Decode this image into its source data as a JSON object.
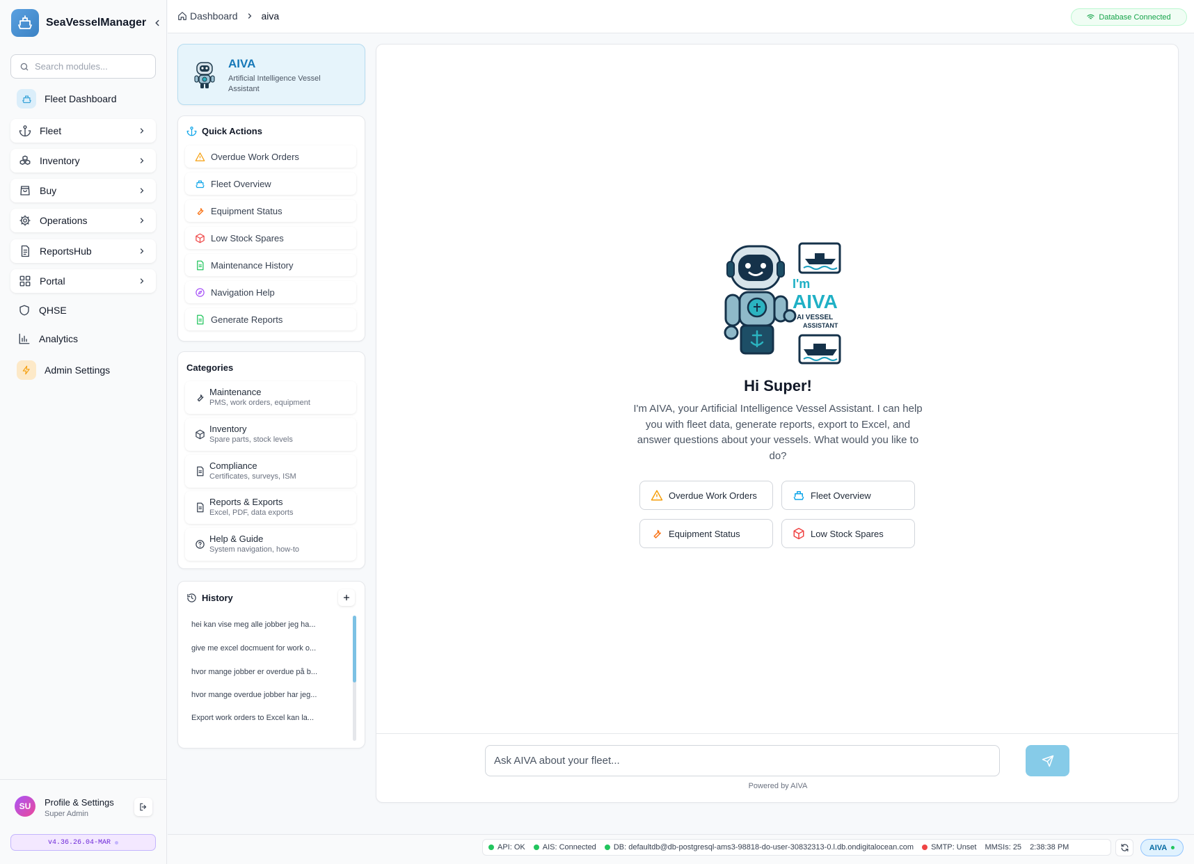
{
  "app": {
    "name": "SeaVesselManager"
  },
  "sidebar": {
    "search_placeholder": "Search modules...",
    "fleet_dashboard": "Fleet Dashboard",
    "items": [
      {
        "label": "Fleet",
        "icon": "anchor-icon"
      },
      {
        "label": "Inventory",
        "icon": "boxes-icon"
      },
      {
        "label": "Buy",
        "icon": "shopping-bag-icon"
      },
      {
        "label": "Operations",
        "icon": "gear-icon"
      },
      {
        "label": "ReportsHub",
        "icon": "document-icon"
      },
      {
        "label": "Portal",
        "icon": "grid-icon"
      }
    ],
    "qhse": "QHSE",
    "analytics": "Analytics",
    "admin": "Admin Settings"
  },
  "profile": {
    "initials": "SU",
    "name": "Profile & Settings",
    "role": "Super Admin"
  },
  "version": "v4.36.26.04-MAR",
  "breadcrumb": {
    "home": "Dashboard",
    "current": "aiva"
  },
  "db_status": "Database Connected",
  "aiva": {
    "title": "AIVA",
    "subtitle": "Artificial Intelligence Vessel Assistant"
  },
  "quick_actions": {
    "title": "Quick Actions",
    "items": [
      {
        "label": "Overdue Work Orders",
        "icon": "warning-icon",
        "color": "#f59e0b"
      },
      {
        "label": "Fleet Overview",
        "icon": "ship-icon",
        "color": "#0ea5e9"
      },
      {
        "label": "Equipment Status",
        "icon": "wrench-icon",
        "color": "#f97316"
      },
      {
        "label": "Low Stock Spares",
        "icon": "package-icon",
        "color": "#ef4444"
      },
      {
        "label": "Maintenance History",
        "icon": "file-icon",
        "color": "#22c55e"
      },
      {
        "label": "Navigation Help",
        "icon": "compass-icon",
        "color": "#a855f7"
      },
      {
        "label": "Generate Reports",
        "icon": "file-icon",
        "color": "#22c55e"
      }
    ]
  },
  "categories": {
    "title": "Categories",
    "items": [
      {
        "title": "Maintenance",
        "sub": "PMS, work orders, equipment"
      },
      {
        "title": "Inventory",
        "sub": "Spare parts, stock levels"
      },
      {
        "title": "Compliance",
        "sub": "Certificates, surveys, ISM"
      },
      {
        "title": "Reports & Exports",
        "sub": "Excel, PDF, data exports"
      },
      {
        "title": "Help & Guide",
        "sub": "System navigation, how-to"
      }
    ]
  },
  "history": {
    "title": "History",
    "items": [
      "hei kan vise meg alle jobber jeg ha...",
      "give me excel docmuent for work o...",
      "hvor mange jobber er overdue på b...",
      "hvor mange overdue jobber har jeg...",
      "Export work orders to Excel kan la..."
    ]
  },
  "chat": {
    "illustration": {
      "line1": "I'm",
      "line2": "AIVA",
      "line3": "AI VESSEL",
      "line4": "ASSISTANT"
    },
    "greeting": "Hi Super!",
    "intro": "I'm AIVA, your Artificial Intelligence Vessel Assistant. I can help you with fleet data, generate reports, export to Excel, and answer questions about your vessels. What would you like to do?",
    "suggestions": [
      "Overdue Work Orders",
      "Fleet Overview",
      "Equipment Status",
      "Low Stock Spares"
    ],
    "input_placeholder": "Ask AIVA about your fleet...",
    "powered_by": "Powered by AIVA"
  },
  "status": {
    "api": "API: OK",
    "ais": "AIS: Connected",
    "db": "DB: defaultdb@db-postgresql-ams3-98818-do-user-30832313-0.l.db.ondigitalocean.com",
    "smtp": "SMTP: Unset",
    "mmsis": "MMSIs: 25",
    "time": "2:38:38 PM",
    "aiva_label": "AIVA",
    "colors": {
      "ok": "#22c55e",
      "error": "#ef4444"
    }
  }
}
